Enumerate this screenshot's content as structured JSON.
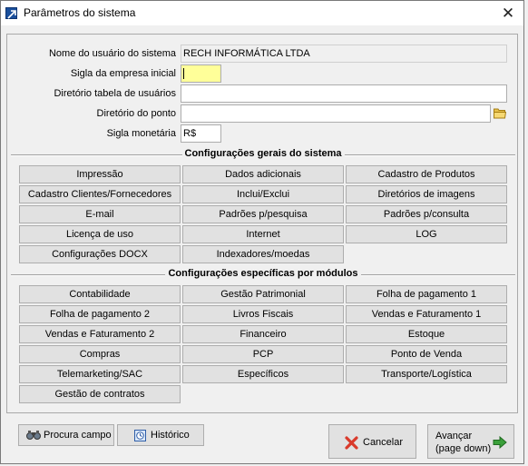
{
  "window": {
    "title": "Parâmetros do sistema",
    "close_glyph": "✕"
  },
  "fields": {
    "usuario": {
      "label": "Nome do usuário do sistema",
      "value": "RECH INFORMÁTICA LTDA"
    },
    "sigla_empresa": {
      "label": "Sigla da empresa inicial",
      "value": ""
    },
    "diretorio_usuarios": {
      "label": "Diretório tabela de usuários",
      "value": ""
    },
    "diretorio_ponto": {
      "label": "Diretório do ponto",
      "value": ""
    },
    "sigla_monetaria": {
      "label": "Sigla monetária",
      "value": "R$"
    }
  },
  "section_general": {
    "title": "Configurações gerais do sistema",
    "buttons": [
      "Impressão",
      "Dados adicionais",
      "Cadastro de Produtos",
      "Cadastro Clientes/Fornecedores",
      "Inclui/Exclui",
      "Diretórios de imagens",
      "E-mail",
      "Padrões p/pesquisa",
      "Padrões p/consulta",
      "Licença de uso",
      "Internet",
      "LOG",
      "Configurações DOCX",
      "Indexadores/moedas"
    ]
  },
  "section_modules": {
    "title": "Configurações específicas por módulos",
    "buttons": [
      "Contabilidade",
      "Gestão Patrimonial",
      "Folha de pagamento 1",
      "Folha de pagamento 2",
      "Livros Fiscais",
      "Vendas e Faturamento 1",
      "Vendas e Faturamento 2",
      "Financeiro",
      "Estoque",
      "Compras",
      "PCP",
      "Ponto de Venda",
      "Telemarketing/SAC",
      "Específicos",
      "Transporte/Logística",
      "Gestão de contratos"
    ]
  },
  "footer": {
    "procura_campo": "Procura campo",
    "historico": "Histórico",
    "cancelar": "Cancelar",
    "avancar_line1": "Avançar",
    "avancar_line2": "(page down)"
  },
  "icons": {
    "app": "app-icon",
    "folder": "folder-icon",
    "binoculars": "binoculars-icon",
    "history": "history-icon",
    "cancel": "cancel-x-icon",
    "next": "arrow-right-icon"
  },
  "colors": {
    "yellow_field": "#ffff99",
    "cancel_red": "#d93a2b",
    "next_green": "#3aa03a"
  }
}
